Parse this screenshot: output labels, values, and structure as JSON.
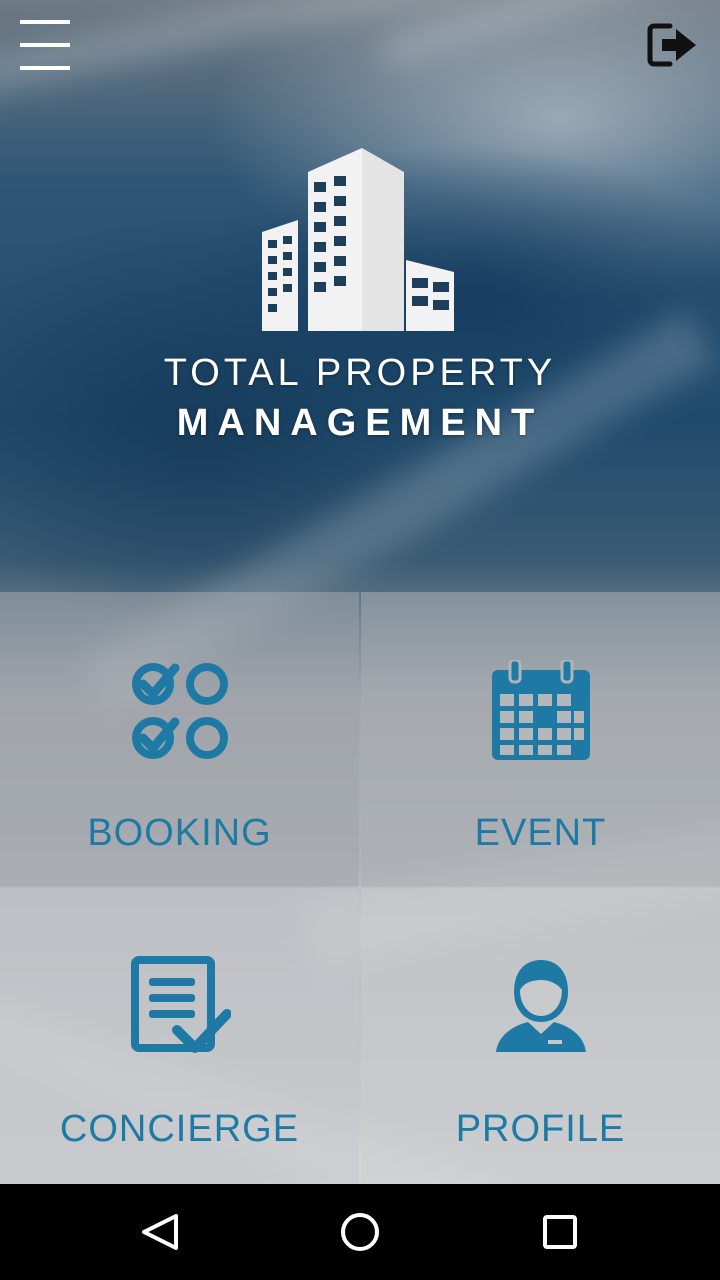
{
  "header": {
    "menu_icon": "hamburger-menu-icon",
    "logout_icon": "logout-icon"
  },
  "brand": {
    "line1": "TOTAL PROPERTY",
    "line2": "MANAGEMENT",
    "logo_icon": "buildings-logo"
  },
  "tiles": [
    {
      "label": "BOOKING",
      "icon": "checklist-circles-icon"
    },
    {
      "label": "EVENT",
      "icon": "calendar-icon"
    },
    {
      "label": "CONCIERGE",
      "icon": "document-check-icon"
    },
    {
      "label": "PROFILE",
      "icon": "user-avatar-icon"
    }
  ],
  "navbar": {
    "back_icon": "back-triangle-icon",
    "home_icon": "home-circle-icon",
    "recent_icon": "recent-apps-square-icon"
  },
  "colors": {
    "accent": "#1e7aa5",
    "text_light": "#ffffff",
    "navbar": "#000000"
  }
}
